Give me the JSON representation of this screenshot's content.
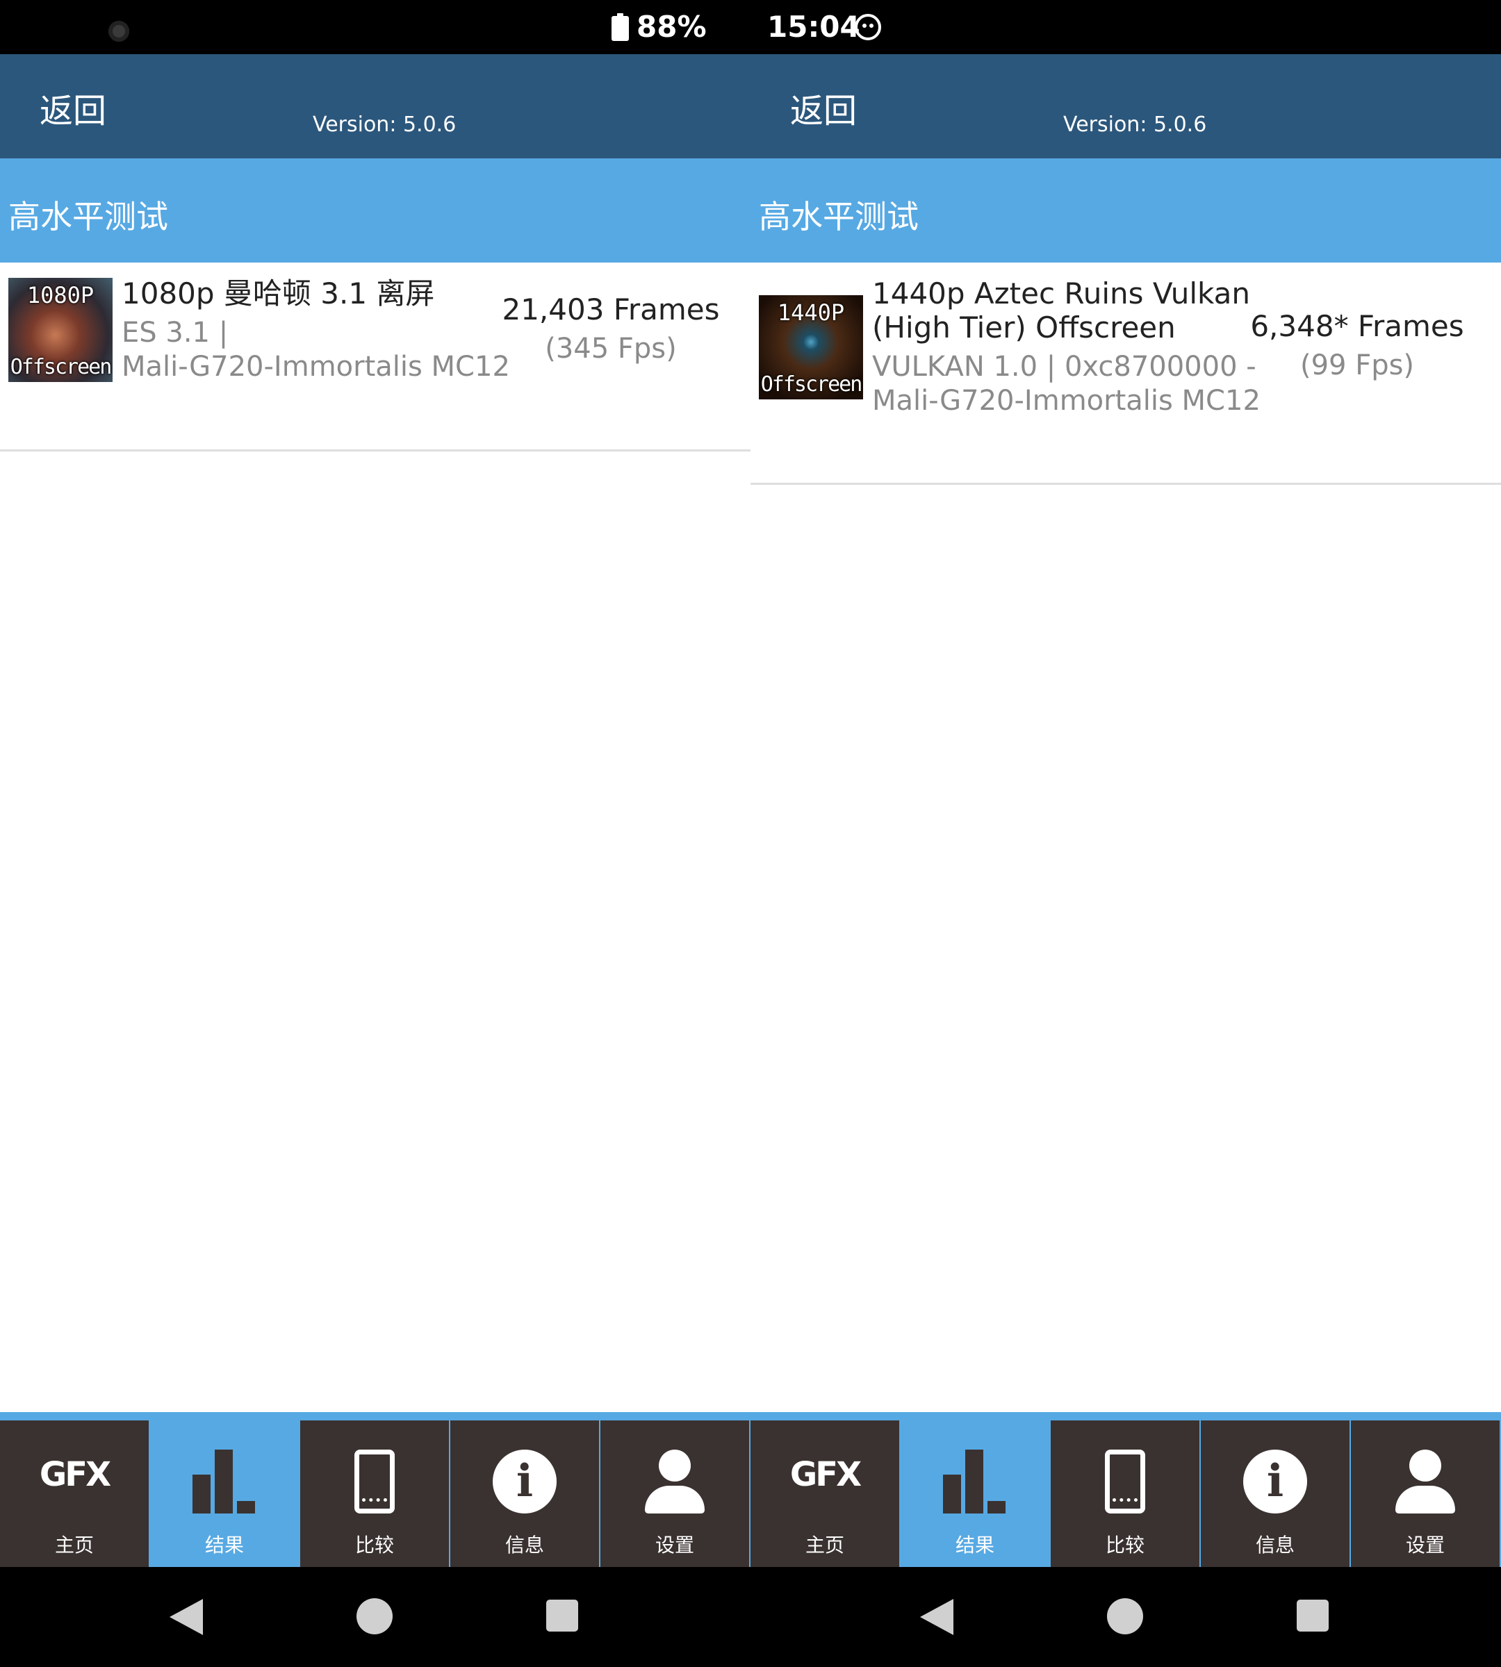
{
  "status_bar": {
    "battery": "88%",
    "time": "15:04"
  },
  "panels": [
    {
      "back_label": "返回",
      "version": "Version: 5.0.6",
      "section_title": "高水平测试",
      "result": {
        "thumb_res": "1080P",
        "thumb_mode": "Offscreen",
        "title": "1080p 曼哈顿 3.1 离屏",
        "api": "ES 3.1 |",
        "gpu": "Mali-G720-Immortalis MC12",
        "frames": "21,403 Frames",
        "fps": "(345 Fps)"
      }
    },
    {
      "back_label": "返回",
      "version": "Version: 5.0.6",
      "section_title": "高水平测试",
      "result": {
        "thumb_res": "1440P",
        "thumb_mode": "Offscreen",
        "title_line1": "1440p Aztec Ruins Vulkan",
        "title_line2": "(High Tier) Offscreen",
        "api": "VULKAN 1.0 | 0xc8700000 -",
        "gpu": "Mali-G720-Immortalis MC12",
        "frames": "6,348* Frames",
        "fps": "(99 Fps)"
      }
    }
  ],
  "bottom_nav": {
    "gfx_logo": "GFX",
    "home": "主页",
    "results": "结果",
    "compare": "比较",
    "info": "信息",
    "settings": "设置",
    "info_glyph": "i",
    "active": "results"
  },
  "colors": {
    "app_bar": "#2c577c",
    "section_bar": "#57a9e3",
    "nav_bg": "#3a3230",
    "active_tab": "#57a9e3"
  }
}
